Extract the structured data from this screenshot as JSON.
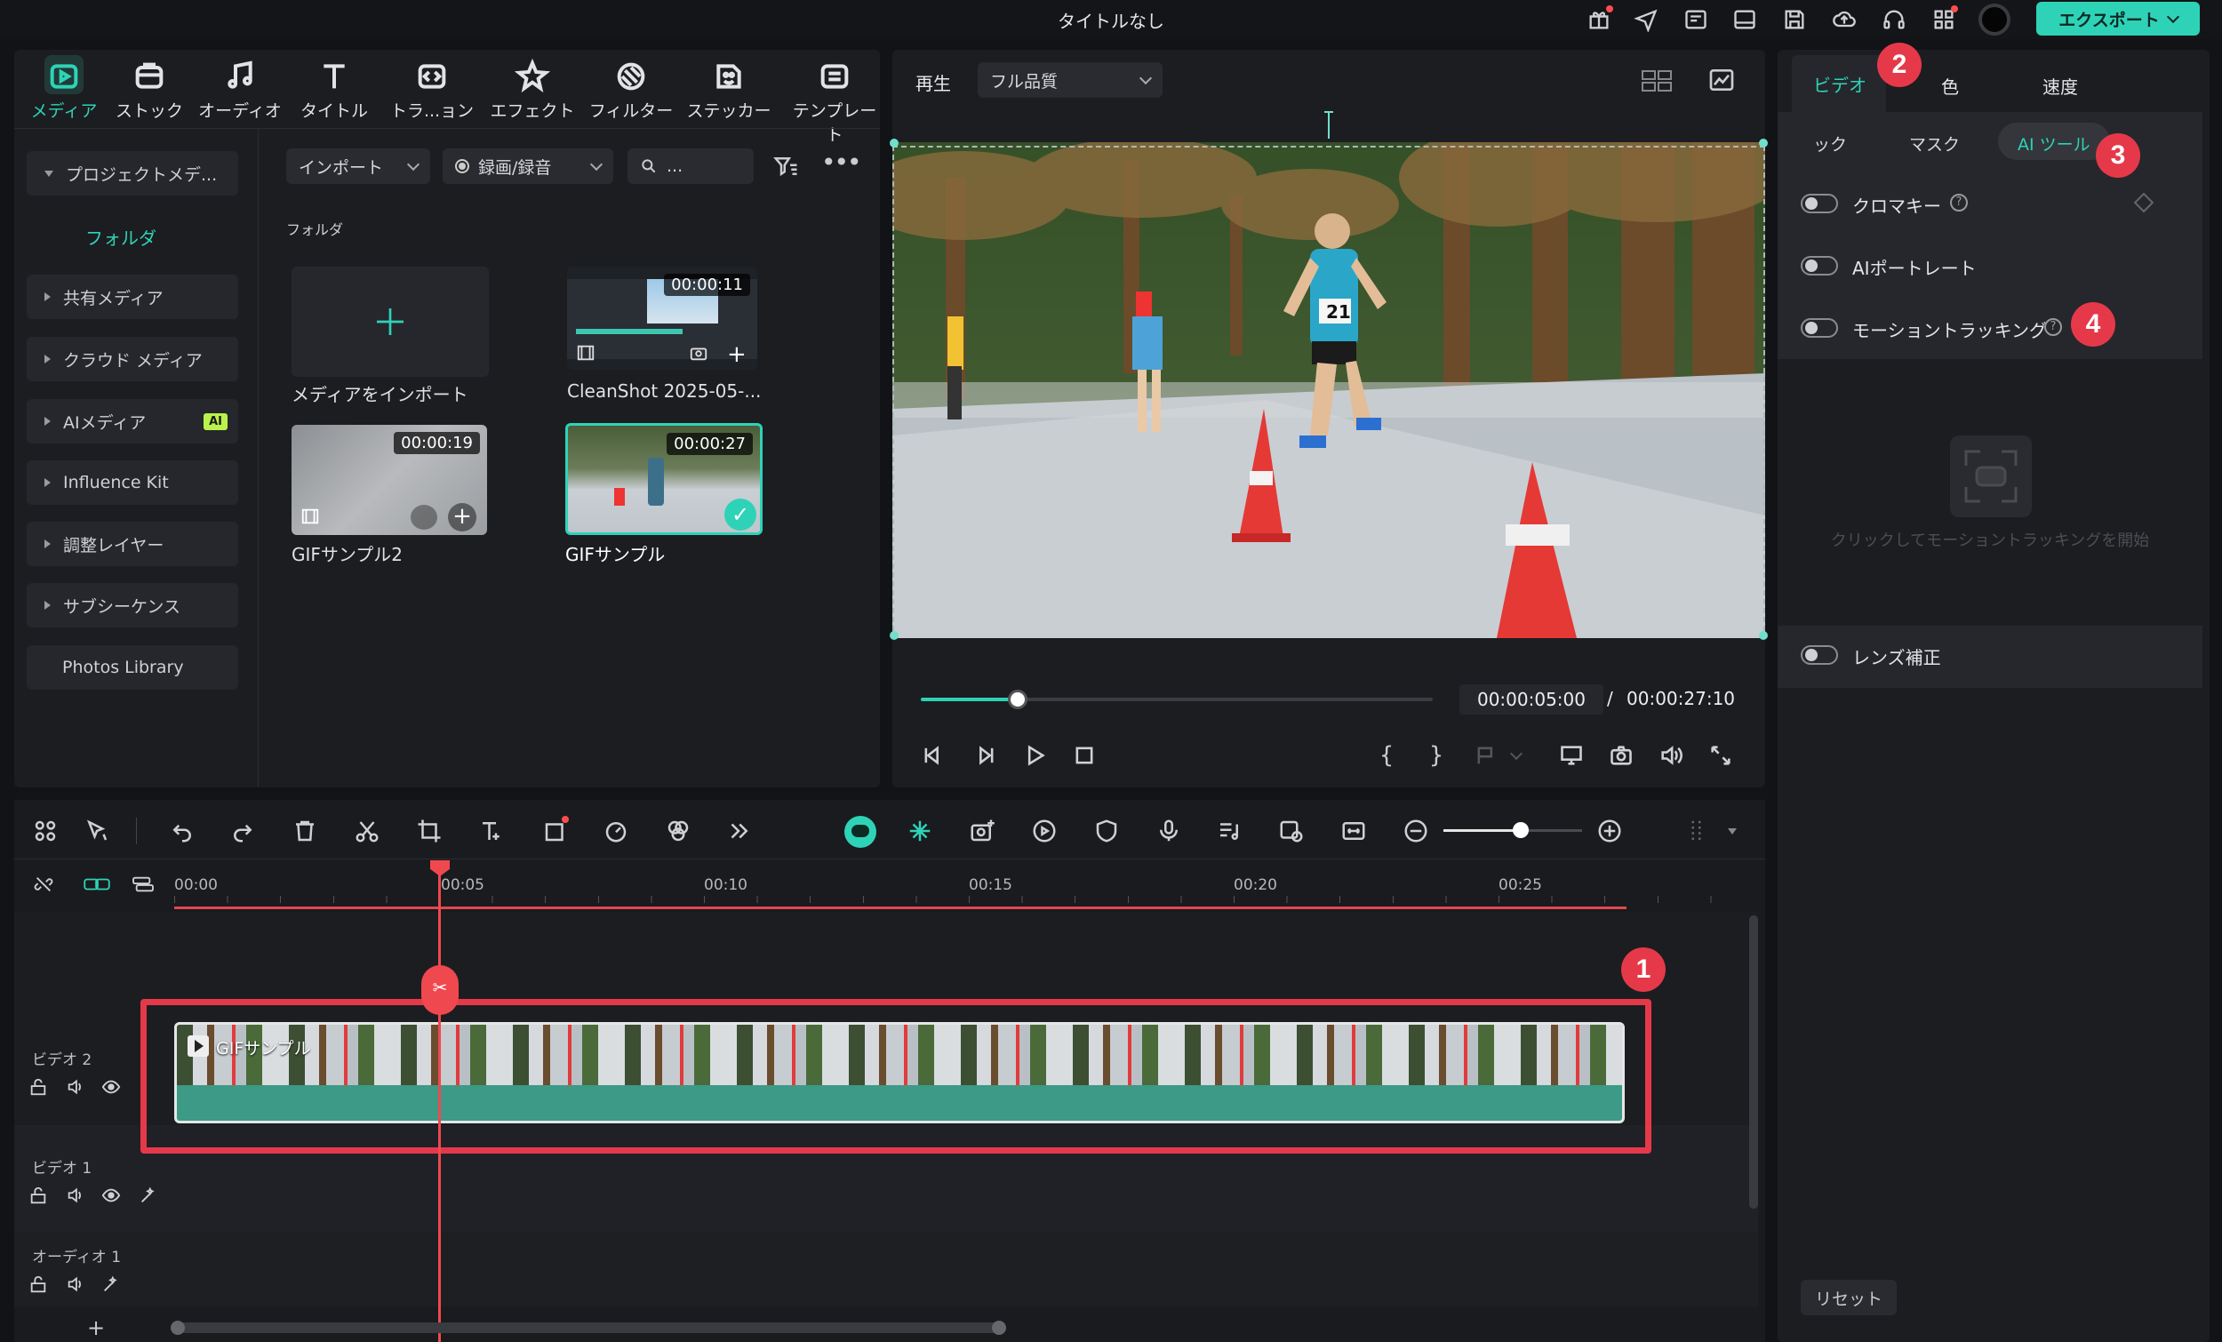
{
  "window": {
    "title": "タイトルなし",
    "export_label": "エクスポート"
  },
  "media_tabs": [
    "メディア",
    "ストック",
    "オーディオ",
    "タイトル",
    "トラ...ョン",
    "エフェクト",
    "フィルター",
    "ステッカー",
    "テンプレート"
  ],
  "sidebar": {
    "project_media": "プロジェクトメデ...",
    "folder": "フォルダ",
    "items": [
      "共有メディア",
      "クラウド メディア",
      "AIメディア",
      "Influence Kit",
      "調整レイヤー",
      "サブシーケンス",
      "Photos Library"
    ],
    "ai_badge": "AI"
  },
  "media_toolbar": {
    "import": "インポート",
    "record": "録画/録音",
    "search_placeholder": "..."
  },
  "media_grid": {
    "folder_label": "フォルダ",
    "import_label": "メディアをインポート",
    "items": [
      {
        "name": "CleanShot 2025-05-...",
        "duration": "00:00:11"
      },
      {
        "name": "GIFサンプル2",
        "duration": "00:00:19"
      },
      {
        "name": "GIFサンプル",
        "duration": "00:00:27"
      }
    ]
  },
  "player": {
    "play_label": "再生",
    "quality": "フル品質",
    "current_time": "00:00:05:00",
    "separator": "/",
    "total_time": "00:00:27:10",
    "progress": 0.19
  },
  "inspector": {
    "tabs": [
      "ビデオ",
      "色",
      "速度"
    ],
    "subtabs": [
      "ック",
      "マスク",
      "AI ツール"
    ],
    "options": [
      {
        "label": "クロマキー"
      },
      {
        "label": "AIポートレート"
      },
      {
        "label": "モーショントラッキング"
      }
    ],
    "motion_hint": "クリックしてモーショントラッキングを開始",
    "lens": "レンズ補正",
    "reset": "リセット"
  },
  "timeline": {
    "ticks": [
      "00:00",
      "00:05",
      "00:10",
      "00:15",
      "00:20",
      "00:25"
    ],
    "tracks": [
      "ビデオ 2",
      "ビデオ 1",
      "オーディオ 1"
    ],
    "clip_label": "GIFサンプル",
    "add_track": "+"
  },
  "annotations": [
    "1",
    "2",
    "3",
    "4"
  ],
  "colors": {
    "accent": "#2ed3b7",
    "annotation": "#e5394a",
    "playhead": "#f0484f"
  }
}
